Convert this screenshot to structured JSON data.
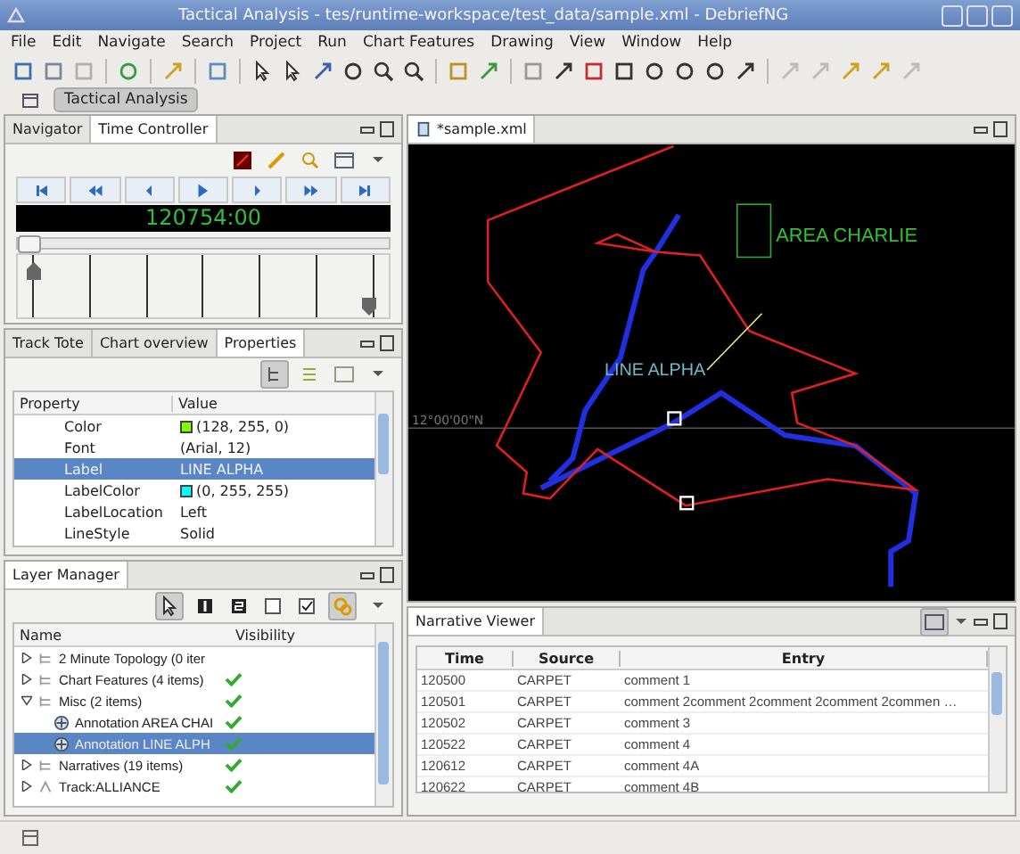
{
  "window": {
    "title": "Tactical Analysis - tes/runtime-workspace/test_data/sample.xml - DebriefNG"
  },
  "menu": [
    "File",
    "Edit",
    "Navigate",
    "Search",
    "Project",
    "Run",
    "Chart Features",
    "Drawing",
    "View",
    "Window",
    "Help"
  ],
  "perspective": {
    "label": "Tactical Analysis",
    "selected": true
  },
  "time_panel": {
    "tabs": [
      {
        "label": "Navigator",
        "selected": false
      },
      {
        "label": "Time Controller",
        "selected": true
      }
    ],
    "time": "120754:00",
    "slider": {
      "level": 0
    },
    "range_start": {
      "level": 0
    },
    "range_end": {
      "level": 1
    }
  },
  "properties_panel": {
    "tabs": [
      {
        "label": "Track Tote",
        "selected": false
      },
      {
        "label": "Chart overview",
        "selected": false
      },
      {
        "label": "Properties",
        "selected": true
      }
    ],
    "columns": [
      "Property",
      "Value"
    ],
    "rows": [
      {
        "property": "Color",
        "value": "(128, 255, 0)",
        "color": "#80ff00",
        "selected": false
      },
      {
        "property": "Font",
        "value": "(Arial, 12)",
        "selected": false
      },
      {
        "property": "Label",
        "value": "LINE ALPHA",
        "selected": true
      },
      {
        "property": "LabelColor",
        "value": "(0, 255, 255)",
        "color": "#00ffff",
        "selected": false
      },
      {
        "property": "LabelLocation",
        "value": "Left",
        "selected": false
      },
      {
        "property": "LineStyle",
        "value": "Solid",
        "selected": false
      }
    ]
  },
  "layer_panel": {
    "tab": "Layer Manager",
    "columns": [
      "Name",
      "Visibility"
    ],
    "items": [
      {
        "label": "2 Minute Topology (0 iter",
        "visible": false,
        "expanded": false,
        "selected": false,
        "kind": "folder"
      },
      {
        "label": "Chart Features (4 items)",
        "visible": true,
        "expanded": false,
        "selected": false,
        "kind": "folder"
      },
      {
        "label": "Misc (2 items)",
        "visible": true,
        "expanded": true,
        "selected": false,
        "kind": "folder",
        "children": [
          {
            "label": "Annotation AREA CHAI",
            "visible": true,
            "selected": false,
            "kind": "annotation"
          },
          {
            "label": "Annotation LINE ALPH",
            "visible": true,
            "selected": true,
            "kind": "annotation"
          }
        ]
      },
      {
        "label": "Narratives (19 items)",
        "visible": true,
        "expanded": false,
        "selected": false,
        "kind": "folder"
      },
      {
        "label": "Track:ALLIANCE",
        "visible": true,
        "expanded": false,
        "selected": false,
        "kind": "track"
      }
    ]
  },
  "editor": {
    "tab": "*sample.xml",
    "area_label": "AREA CHARLIE",
    "line_label": "LINE ALPHA",
    "grid_label": "12°00'00\"N"
  },
  "narrative_panel": {
    "tab": "Narrative Viewer",
    "columns": [
      "Time",
      "Source",
      "Entry"
    ],
    "rows": [
      {
        "time": "120500",
        "source": "CARPET",
        "entry": "comment 1"
      },
      {
        "time": "120501",
        "source": "CARPET",
        "entry": "comment 2comment 2comment 2comment 2commen …"
      },
      {
        "time": "120502",
        "source": "CARPET",
        "entry": "comment 3"
      },
      {
        "time": "120522",
        "source": "CARPET",
        "entry": "comment 4"
      },
      {
        "time": "120612",
        "source": "CARPET",
        "entry": "comment 4A"
      },
      {
        "time": "120622",
        "source": "CARPET",
        "entry": "comment 4B"
      }
    ]
  }
}
